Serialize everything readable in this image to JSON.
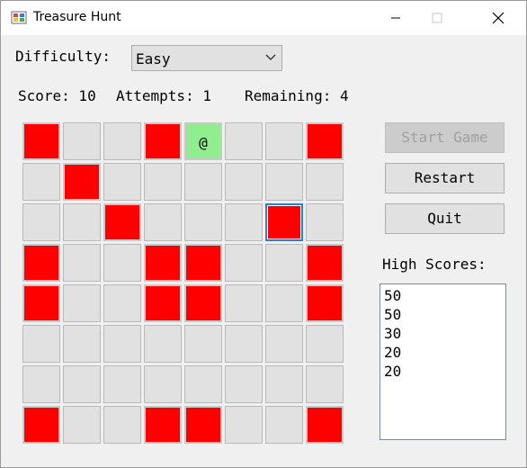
{
  "window": {
    "title": "Treasure Hunt",
    "controls": {
      "minimize": "–",
      "maximize": "□",
      "close": "✕"
    }
  },
  "difficulty": {
    "label": "Difficulty:",
    "selected": "Easy"
  },
  "status": {
    "score": "Score: 10",
    "attempts": "Attempts: 1",
    "remaining": "Remaining: 4"
  },
  "board": {
    "rows": 8,
    "cols": 8,
    "red_color": "#ff0000",
    "found_color": "#90ee90",
    "empty_color": "#e1e1e1",
    "cells": [
      [
        "red",
        "",
        "",
        "red",
        "found",
        "",
        "",
        "red"
      ],
      [
        "",
        "red",
        "",
        "",
        "",
        "",
        "",
        ""
      ],
      [
        "",
        "",
        "red",
        "",
        "",
        "",
        "selected-red",
        ""
      ],
      [
        "red",
        "",
        "",
        "red",
        "red",
        "",
        "",
        "red"
      ],
      [
        "red",
        "",
        "",
        "red",
        "red",
        "",
        "",
        "red"
      ],
      [
        "",
        "",
        "",
        "",
        "",
        "",
        "",
        ""
      ],
      [
        "",
        "",
        "",
        "",
        "",
        "",
        "",
        ""
      ],
      [
        "red",
        "",
        "",
        "red",
        "red",
        "",
        "",
        "red"
      ]
    ],
    "found_text": "@"
  },
  "buttons": {
    "start": "Start Game",
    "restart": "Restart",
    "quit": "Quit"
  },
  "high_scores": {
    "label": "High Scores:",
    "items": [
      "50",
      "50",
      "30",
      "20",
      "20"
    ]
  }
}
